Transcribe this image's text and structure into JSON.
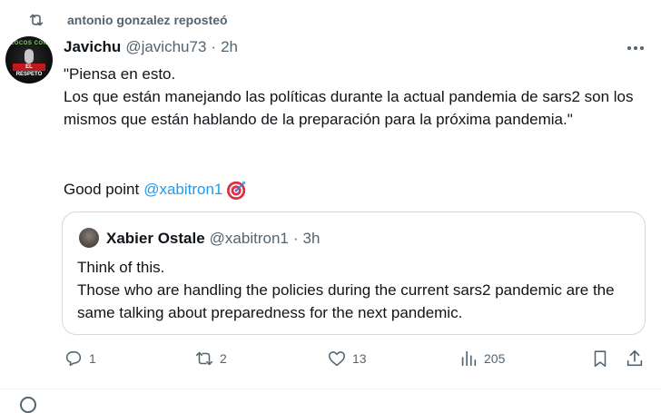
{
  "repost": {
    "icon": "repost-icon",
    "text": "antonio gonzalez reposteó"
  },
  "tweet": {
    "author_name": "Javichu",
    "author_handle": "@javichu73",
    "separator": "·",
    "time": "2h",
    "avatar_icon": "avatar",
    "avatar_text": {
      "top": "LOCOS CON",
      "banner": "EL RESPETO"
    },
    "lines": [
      "\"Piensa en esto.",
      "Los que están manejando las políticas durante la actual pandemia de sars2 son los mismos que están hablando de la preparación para la próxima pandemia.\""
    ],
    "good_point_prefix": "Good point",
    "mention": "@xabitron1",
    "emoji_icon": "direct-hit-icon",
    "more_icon": "more-icon"
  },
  "quote": {
    "author_name": "Xabier Ostale",
    "author_handle": "@xabitron1",
    "separator": "·",
    "time": "3h",
    "lines": [
      "Think of this.",
      "Those who are handling the policies during the current sars2 pandemic are the same talking about preparedness for the next pandemic."
    ]
  },
  "actions": {
    "reply": {
      "icon": "reply-icon",
      "count": "1"
    },
    "repost": {
      "icon": "repost-icon",
      "count": "2"
    },
    "like": {
      "icon": "heart-icon",
      "count": "13"
    },
    "views": {
      "icon": "views-icon",
      "count": "205"
    },
    "bookmark": {
      "icon": "bookmark-icon"
    },
    "share": {
      "icon": "share-icon"
    }
  },
  "colors": {
    "text": "#0f1419",
    "muted": "#536471",
    "link": "#1d9bf0",
    "border": "#cfd9de"
  }
}
